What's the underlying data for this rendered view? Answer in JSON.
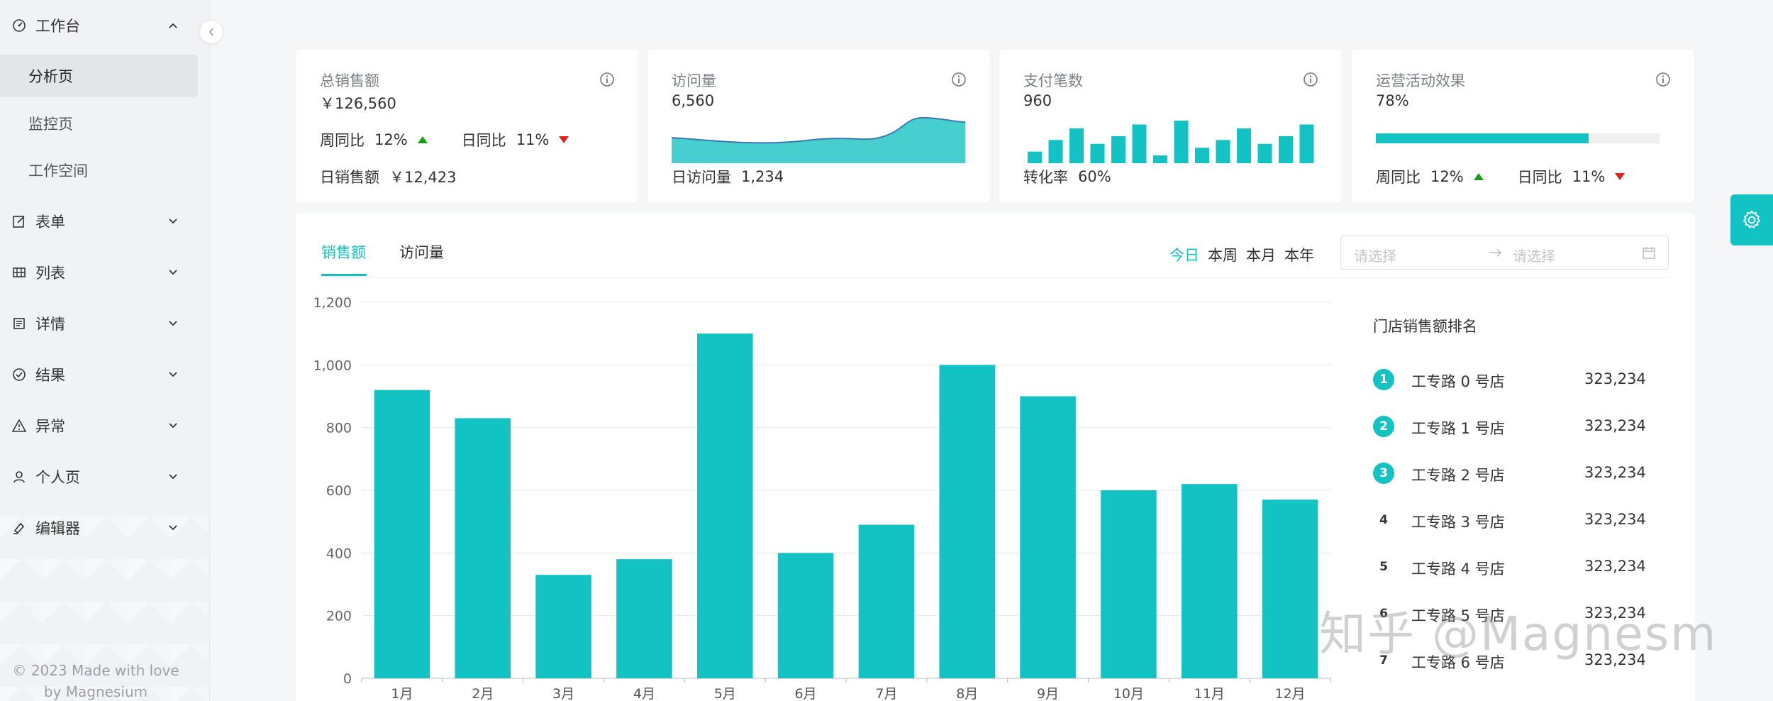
{
  "theme": {
    "accent": "#13c2c2",
    "up_color": "#1a9a1a",
    "down_color": "#e0201a"
  },
  "sidebar": {
    "groups": [
      {
        "label": "工作台",
        "icon": "dashboard-icon",
        "expanded": true
      },
      {
        "label": "表单",
        "icon": "form-icon"
      },
      {
        "label": "列表",
        "icon": "table-icon"
      },
      {
        "label": "详情",
        "icon": "profile-icon"
      },
      {
        "label": "结果",
        "icon": "check-circle-icon"
      },
      {
        "label": "异常",
        "icon": "warning-icon"
      },
      {
        "label": "个人页",
        "icon": "user-icon"
      },
      {
        "label": "编辑器",
        "icon": "highlight-icon"
      }
    ],
    "sub_items": [
      {
        "label": "分析页",
        "active": true
      },
      {
        "label": "监控页"
      },
      {
        "label": "工作空间"
      }
    ],
    "footer_line1": "© 2023 Made with love",
    "footer_line2": "by Magnesium"
  },
  "cards": [
    {
      "title": "总销售额",
      "value": "￥126,560",
      "week_label": "周同比",
      "week_value": "12%",
      "day_label": "日同比",
      "day_value": "11%",
      "footer_label": "日销售额",
      "footer_value": "￥12,423"
    },
    {
      "title": "访问量",
      "value": "6,560",
      "footer_label": "日访问量",
      "footer_value": "1,234"
    },
    {
      "title": "支付笔数",
      "value": "960",
      "footer_label": "转化率",
      "footer_value": "60%",
      "mini_bars": [
        3,
        6,
        9,
        5,
        7,
        10,
        2,
        11,
        4,
        6,
        9,
        5,
        7,
        10
      ]
    },
    {
      "title": "运营活动效果",
      "value": "78%",
      "progress": 0.75,
      "week_label": "周同比",
      "week_value": "12%",
      "day_label": "日同比",
      "day_value": "11%"
    }
  ],
  "main": {
    "tabs": [
      "销售额",
      "访问量"
    ],
    "active_tab": 0,
    "ranges": [
      "今日",
      "本周",
      "本月",
      "本年"
    ],
    "active_range": 0,
    "date_start_placeholder": "请选择",
    "date_end_placeholder": "请选择"
  },
  "chart_data": {
    "type": "bar",
    "categories": [
      "1月",
      "2月",
      "3月",
      "4月",
      "5月",
      "6月",
      "7月",
      "8月",
      "9月",
      "10月",
      "11月",
      "12月"
    ],
    "values": [
      920,
      830,
      330,
      380,
      1100,
      400,
      490,
      1000,
      900,
      600,
      620,
      570
    ],
    "yticks": [
      "0",
      "200",
      "400",
      "600",
      "800",
      "1,000",
      "1,200"
    ],
    "ylim": [
      0,
      1200
    ],
    "grid": true,
    "color": "#13c2c2"
  },
  "ranking": {
    "title": "门店销售额排名",
    "items": [
      {
        "rank": "1",
        "name": "工专路 0 号店",
        "value": "323,234"
      },
      {
        "rank": "2",
        "name": "工专路 1 号店",
        "value": "323,234"
      },
      {
        "rank": "3",
        "name": "工专路 2 号店",
        "value": "323,234"
      },
      {
        "rank": "4",
        "name": "工专路 3 号店",
        "value": "323,234"
      },
      {
        "rank": "5",
        "name": "工专路 4 号店",
        "value": "323,234"
      },
      {
        "rank": "6",
        "name": "工专路 5 号店",
        "value": "323,234"
      },
      {
        "rank": "7",
        "name": "工专路 6 号店",
        "value": "323,234"
      }
    ]
  },
  "watermark": "知乎 @Magnesm"
}
